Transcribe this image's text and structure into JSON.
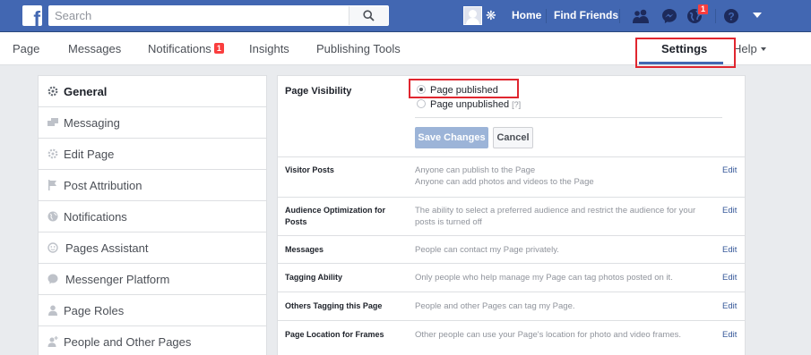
{
  "topbar": {
    "logo": "f",
    "search_placeholder": "Search",
    "home": "Home",
    "find_friends": "Find Friends",
    "notification_count": "1",
    "icons": [
      "search-icon",
      "avatar",
      "gear-icon",
      "friends-icon",
      "messenger-icon",
      "globe-icon",
      "help-icon",
      "caret-down-icon"
    ]
  },
  "tabs": {
    "page": "Page",
    "messages": "Messages",
    "notifications": "Notifications",
    "notifications_badge": "1",
    "insights": "Insights",
    "publishing_tools": "Publishing Tools",
    "settings": "Settings",
    "help": "Help"
  },
  "sidebar": {
    "items": [
      {
        "label": "General",
        "icon": "gear-icon"
      },
      {
        "label": "Messaging",
        "icon": "messaging-icon"
      },
      {
        "label": "Edit Page",
        "icon": "gear-icon"
      },
      {
        "label": "Post Attribution",
        "icon": "flag-icon"
      },
      {
        "label": "Notifications",
        "icon": "globe-icon"
      },
      {
        "label": "Pages Assistant",
        "icon": "assistant-icon"
      },
      {
        "label": "Messenger Platform",
        "icon": "messenger-icon"
      },
      {
        "label": "Page Roles",
        "icon": "person-icon"
      },
      {
        "label": "People and Other Pages",
        "icon": "add-person-icon"
      }
    ]
  },
  "visibility": {
    "title": "Page Visibility",
    "published": "Page published",
    "unpublished": "Page unpublished",
    "hint": "[?]",
    "save": "Save Changes",
    "cancel": "Cancel"
  },
  "settings_rows": [
    {
      "key": "Visitor Posts",
      "value": "Anyone can publish to the Page",
      "value2": "Anyone can add photos and videos to the Page",
      "edit": "Edit"
    },
    {
      "key": "Audience Optimization for Posts",
      "value": "The ability to select a preferred audience and restrict the audience for your posts is turned off",
      "value2": "",
      "edit": "Edit"
    },
    {
      "key": "Messages",
      "value": "People can contact my Page privately.",
      "value2": "",
      "edit": "Edit"
    },
    {
      "key": "Tagging Ability",
      "value": "Only people who help manage my Page can tag photos posted on it.",
      "value2": "",
      "edit": "Edit"
    },
    {
      "key": "Others Tagging this Page",
      "value": "People and other Pages can tag my Page.",
      "value2": "",
      "edit": "Edit"
    },
    {
      "key": "Page Location for Frames",
      "value": "Other people can use your Page's location for photo and video frames.",
      "value2": "",
      "edit": "Edit"
    }
  ],
  "colors": {
    "brand": "#4267b2",
    "highlight": "#e0262f",
    "link": "#365899"
  }
}
